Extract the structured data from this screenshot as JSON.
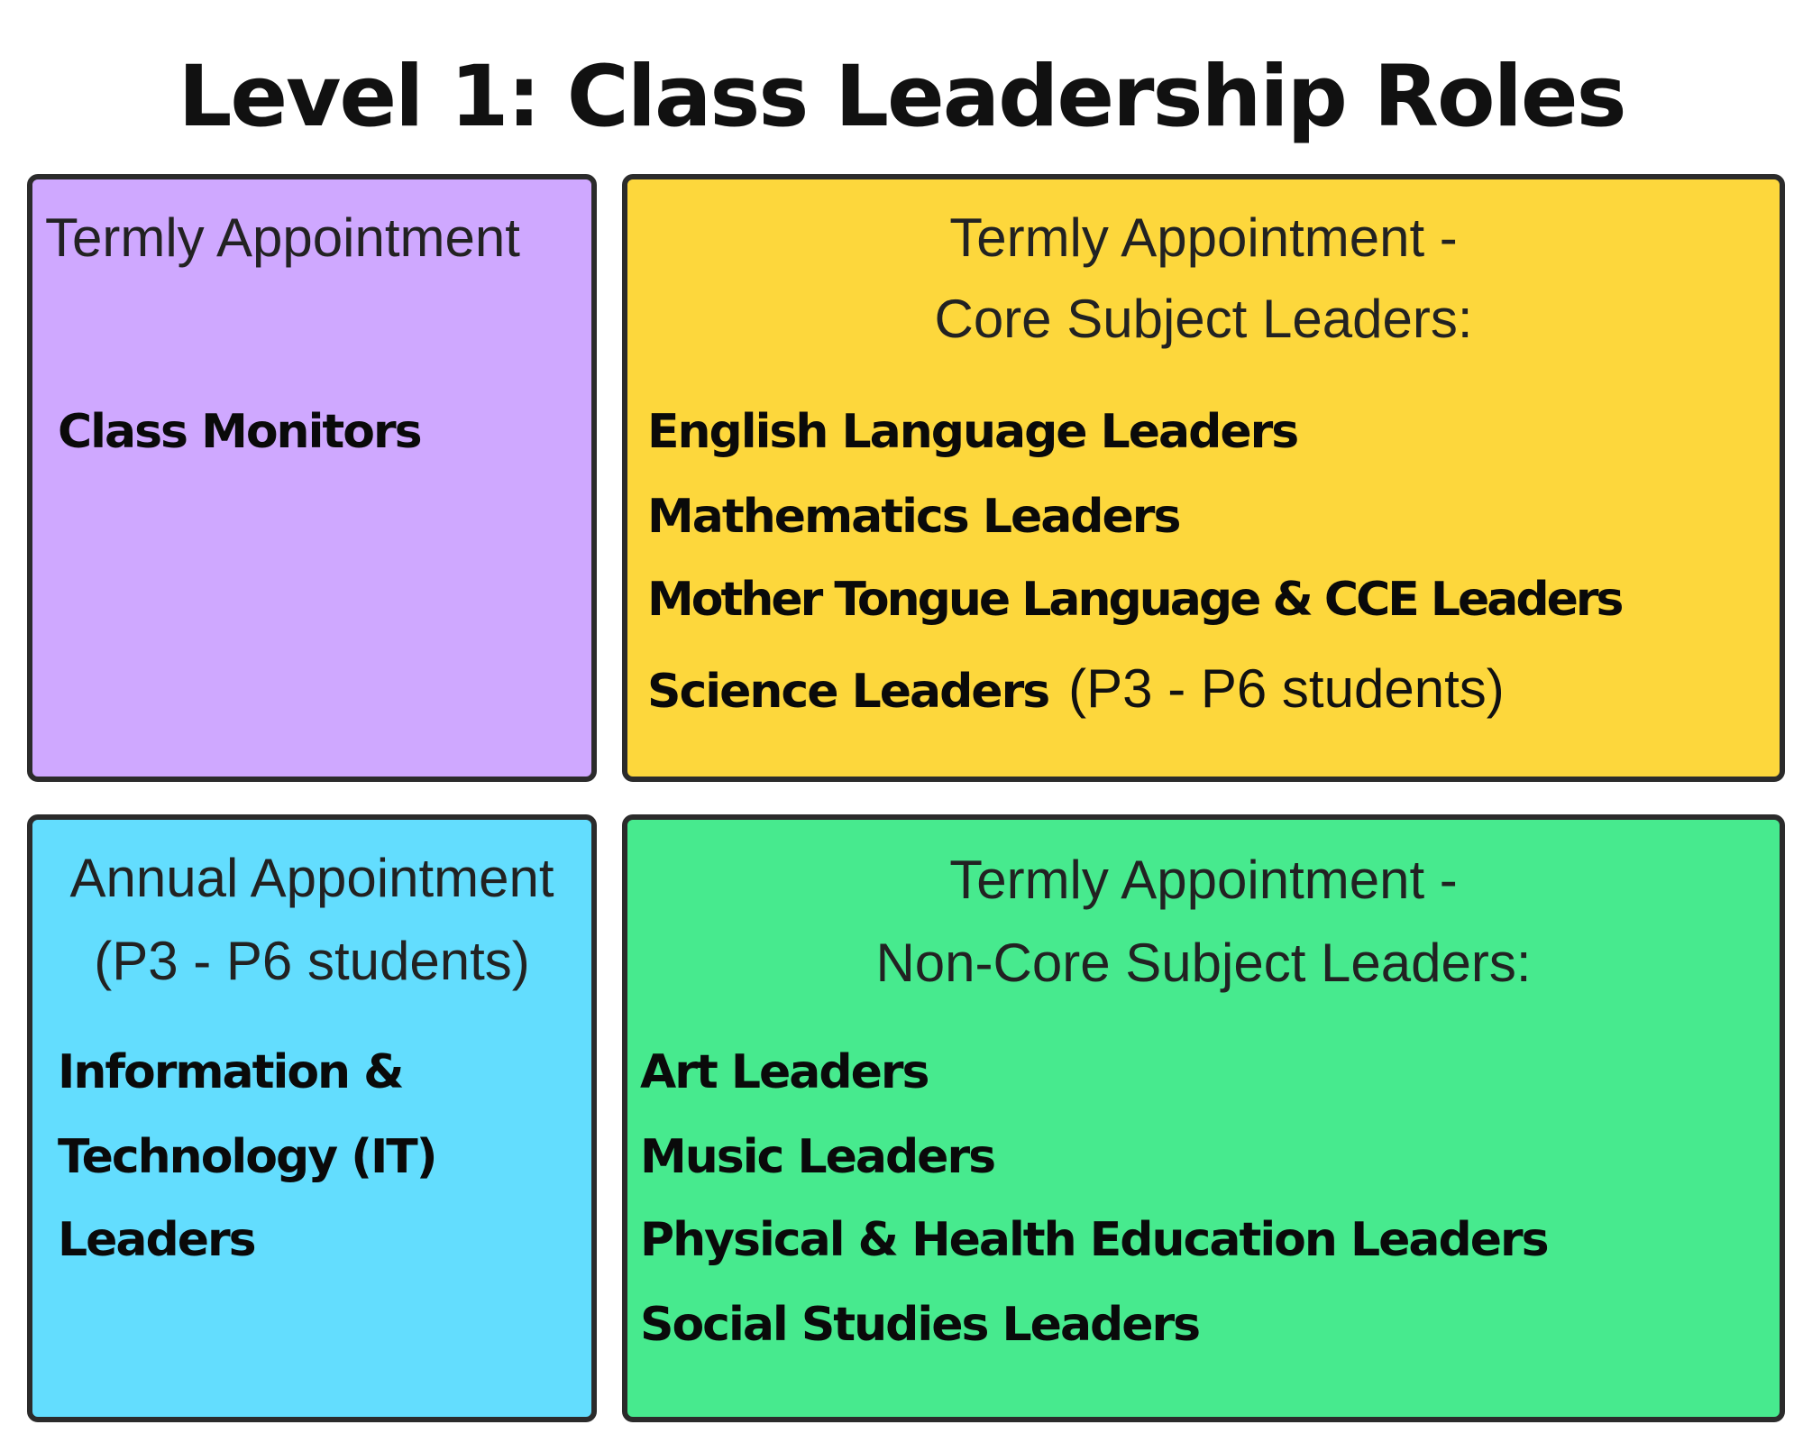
{
  "title": "Level 1: Class Leadership Roles",
  "colors": {
    "purple_box": "#cfa8ff",
    "yellow_box": "#fdd73c",
    "blue_box": "#63ddfe",
    "green_box": "#47ea8e",
    "border": "#2b2b2b"
  },
  "boxes": {
    "top_left": {
      "heading": "Termly Appointment",
      "items": [
        "Class Monitors"
      ]
    },
    "top_right": {
      "heading_line1": "Termly Appointment -",
      "heading_line2": "Core Subject Leaders:",
      "items": [
        "English Language Leaders",
        "Mathematics Leaders",
        "Mother Tongue Language & CCE Leaders",
        "Science Leaders"
      ],
      "science_note": "(P3 - P6 students)"
    },
    "bottom_left": {
      "heading_line1": "Annual Appointment",
      "heading_line2": "(P3 - P6 students)",
      "items": [
        "Information &",
        "Technology (IT)",
        "Leaders"
      ]
    },
    "bottom_right": {
      "heading_line1": "Termly Appointment -",
      "heading_line2": "Non-Core Subject Leaders:",
      "items": [
        "Art Leaders",
        "Music Leaders",
        "Physical & Health Education Leaders",
        "Social Studies Leaders"
      ]
    }
  }
}
